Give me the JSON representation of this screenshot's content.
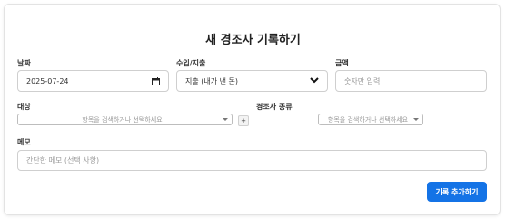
{
  "form": {
    "title": "새 경조사 기록하기",
    "date": {
      "label": "날짜",
      "value": "2025-07-24",
      "icon": "calendar-icon"
    },
    "type": {
      "label": "수입/지출",
      "value": "지출 (내가 낸 돈)",
      "icon": "chevron-down-icon"
    },
    "amount": {
      "label": "금액",
      "placeholder": "숫자만 입력"
    },
    "target": {
      "label": "대상",
      "placeholder": "항목을 검색하거나 선택하세요",
      "add_label": "+"
    },
    "event_kind": {
      "label": "경조사 종류",
      "placeholder": "항목을 검색하거나 선택하세요"
    },
    "memo": {
      "label": "메모",
      "placeholder": "간단한 메모 (선택 사항)"
    },
    "submit_label": "기록 추가하기"
  },
  "colors": {
    "accent": "#1473e6"
  }
}
